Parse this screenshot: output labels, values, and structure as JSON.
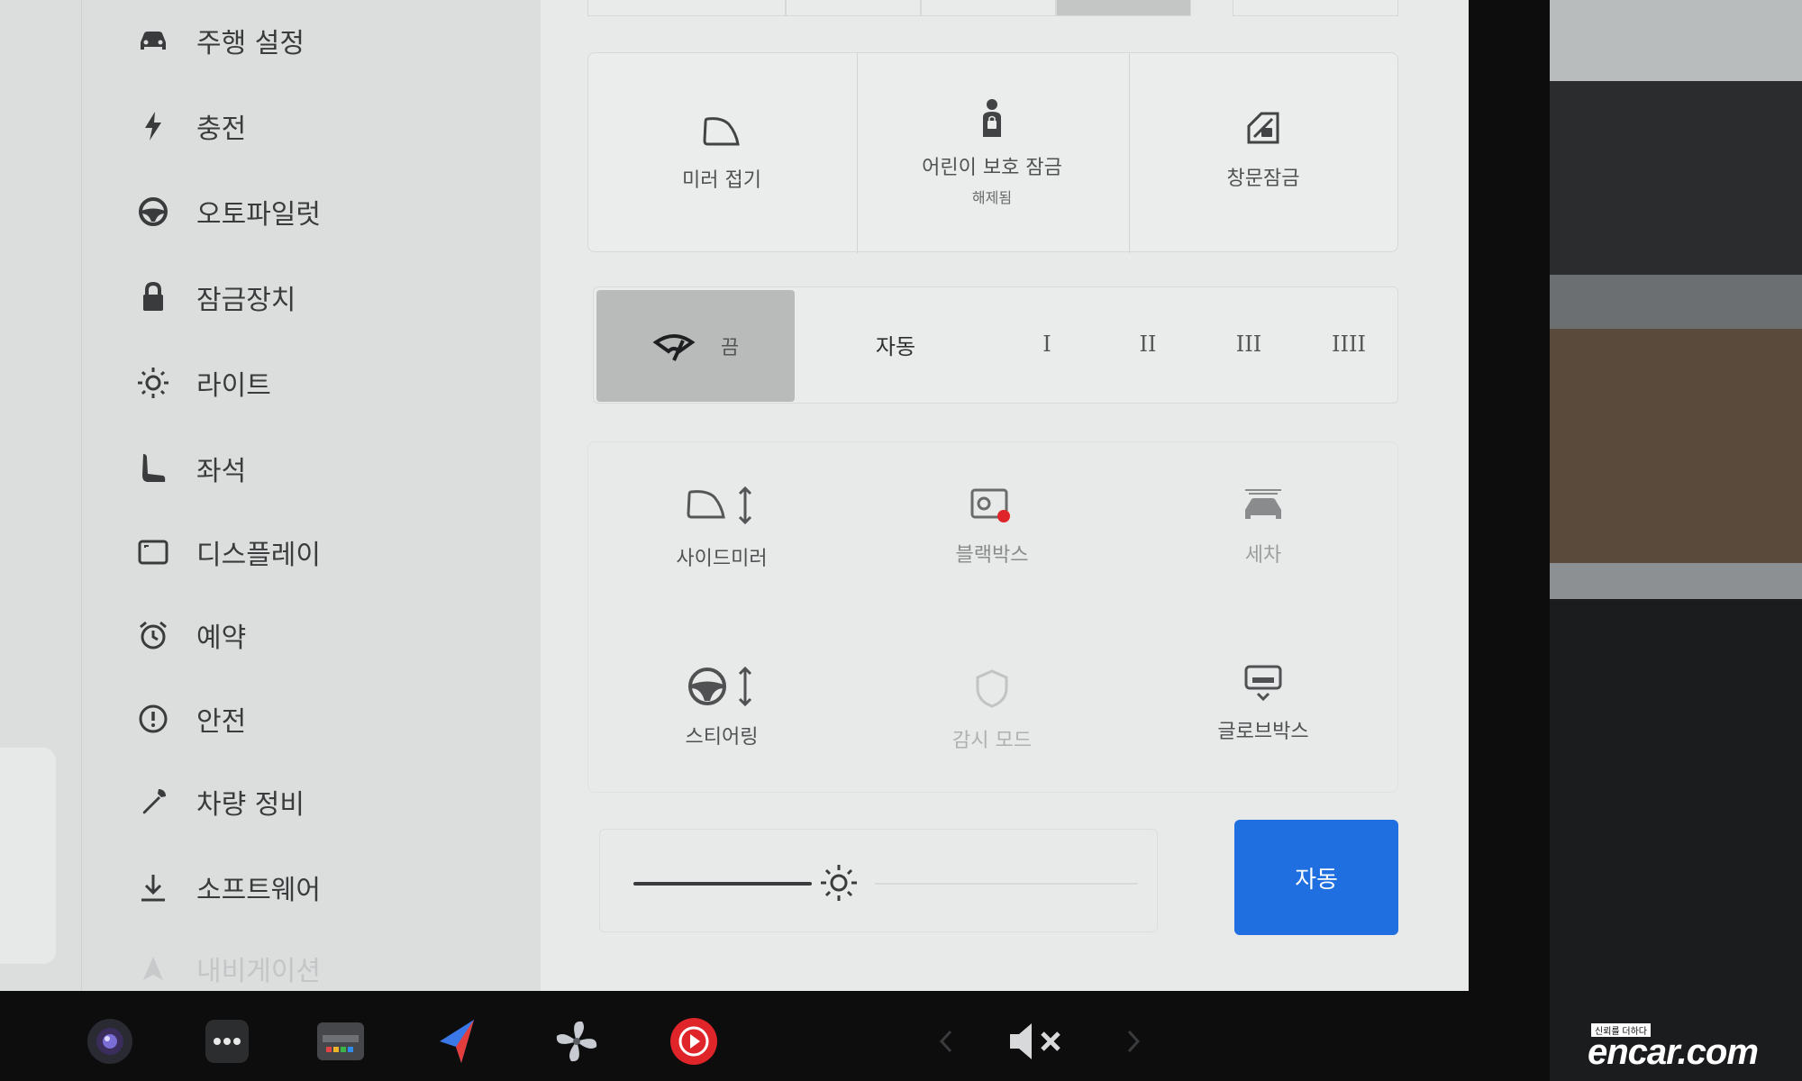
{
  "sidebar": {
    "items": [
      {
        "label": "주행 설정",
        "icon": "car-icon"
      },
      {
        "label": "충전",
        "icon": "lightning-icon"
      },
      {
        "label": "오토파일럿",
        "icon": "steering-wheel-icon"
      },
      {
        "label": "잠금장치",
        "icon": "lock-icon"
      },
      {
        "label": "라이트",
        "icon": "sun-icon"
      },
      {
        "label": "좌석",
        "icon": "seat-icon"
      },
      {
        "label": "디스플레이",
        "icon": "display-icon"
      },
      {
        "label": "예약",
        "icon": "alarm-clock-icon"
      },
      {
        "label": "안전",
        "icon": "info-circle-icon"
      },
      {
        "label": "차량 정비",
        "icon": "wrench-icon"
      },
      {
        "label": "소프트웨어",
        "icon": "download-icon"
      },
      {
        "label": "내비게이션",
        "icon": "navigation-icon"
      }
    ]
  },
  "quick_controls": {
    "mirror_fold": {
      "label": "미러 접기",
      "icon": "mirror-icon"
    },
    "child_lock": {
      "label": "어린이 보호 잠금",
      "status": "해제됨",
      "icon": "child-lock-icon"
    },
    "window_lock": {
      "label": "창문잠금",
      "icon": "window-lock-icon"
    }
  },
  "wipers": {
    "options": [
      {
        "label": "끔",
        "active": true,
        "icon": "wiper-icon"
      },
      {
        "label": "자동",
        "active": false
      },
      {
        "label": "I",
        "active": false
      },
      {
        "label": "II",
        "active": false
      },
      {
        "label": "III",
        "active": false
      },
      {
        "label": "IIII",
        "active": false
      }
    ]
  },
  "secondary_controls": [
    {
      "label": "사이드미러",
      "icon": "side-mirror-adjust-icon",
      "dim": false
    },
    {
      "label": "블랙박스",
      "icon": "dashcam-icon",
      "dim": false,
      "recording": true
    },
    {
      "label": "세차",
      "icon": "car-wash-icon",
      "dim": false
    },
    {
      "label": "스티어링",
      "icon": "steering-adjust-icon",
      "dim": false
    },
    {
      "label": "감시 모드",
      "icon": "sentry-icon",
      "dim": true
    },
    {
      "label": "글로브박스",
      "icon": "glovebox-icon",
      "dim": false
    }
  ],
  "display_brightness": {
    "level": 0.38,
    "icon": "brightness-icon",
    "auto_label": "자동"
  },
  "taskbar": {
    "items": [
      "camera-icon",
      "more-icon",
      "toybox-icon",
      "navigation-arrow-icon",
      "fan-icon",
      "media-play-icon"
    ],
    "volume": {
      "muted": true,
      "icon": "volume-mute-icon",
      "left_icon": "chevron-left-icon",
      "right_icon": "chevron-right-icon"
    }
  },
  "watermark": {
    "small_text": "신뢰를 더하다",
    "brand": "encar.com"
  },
  "colors": {
    "accent": "#1f6fe0",
    "record": "#e0252a",
    "active_segment": "#b9baba"
  }
}
